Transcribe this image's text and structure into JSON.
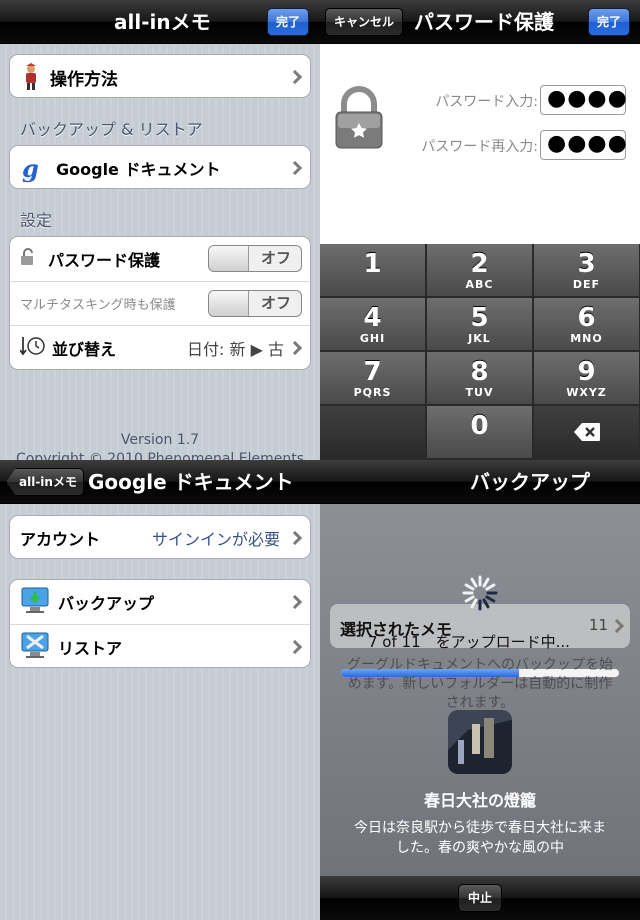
{
  "top_left": {
    "title": "all-inメモ",
    "done_button": "完了",
    "howto_label": "操作方法",
    "backup_section_header": "バックアップ & リストア",
    "google_docs_label": "Google ドキュメント",
    "settings_header": "設定",
    "password_label": "パスワード保護",
    "password_toggle": "オフ",
    "multitask_label": "マルチタスキング時も保護",
    "multitask_toggle": "オフ",
    "sort_label": "並び替え",
    "sort_value": "日付: 新 ▶ 古",
    "version": "Version 1.7",
    "copyright": "Copyright © 2010 Phenomenal Elements"
  },
  "top_right": {
    "cancel_button": "キャンセル",
    "title": "パスワード保護",
    "done_button": "完了",
    "password_input_label": "パスワード入力:",
    "password_reentry_label": "パスワード再入力:",
    "password_input_value": "●●●●",
    "password_reentry_value": "●●●●",
    "keys": [
      {
        "num": "1",
        "sub": ""
      },
      {
        "num": "2",
        "sub": "ABC"
      },
      {
        "num": "3",
        "sub": "DEF"
      },
      {
        "num": "4",
        "sub": "GHI"
      },
      {
        "num": "5",
        "sub": "JKL"
      },
      {
        "num": "6",
        "sub": "MNO"
      },
      {
        "num": "7",
        "sub": "PQRS"
      },
      {
        "num": "8",
        "sub": "TUV"
      },
      {
        "num": "9",
        "sub": "WXYZ"
      },
      {
        "num": "",
        "sub": ""
      },
      {
        "num": "0",
        "sub": ""
      },
      {
        "num": "⌫",
        "sub": ""
      }
    ]
  },
  "bottom_left": {
    "back_button": "all-inメモ",
    "title": "Google ドキュメント",
    "account_label": "アカウント",
    "account_value": "サインインが必要",
    "backup_label": "バックアップ",
    "restore_label": "リストア"
  },
  "bottom_right": {
    "title": "バックアップ",
    "selected_memo_label": "選択されたメモ",
    "selected_memo_count": "11",
    "progress_text": "7 of 11　をアップロード中...",
    "progress_fraction": 0.64,
    "info_text": "グーグルドキュメントへのバックップを始めます。新しいフォルダーは自動的に制作されます。",
    "memo_title": "春日大社の燈籠",
    "memo_body": "今日は奈良駅から徒歩で春日大社に来ました。春の爽やかな風の中",
    "stop_button": "中止"
  },
  "colors": {
    "nav_blue": "#2a6ce0",
    "link_blue": "#385487",
    "progress_blue": "#3b7fe0",
    "stripe_bg": "#c5ccd4"
  }
}
